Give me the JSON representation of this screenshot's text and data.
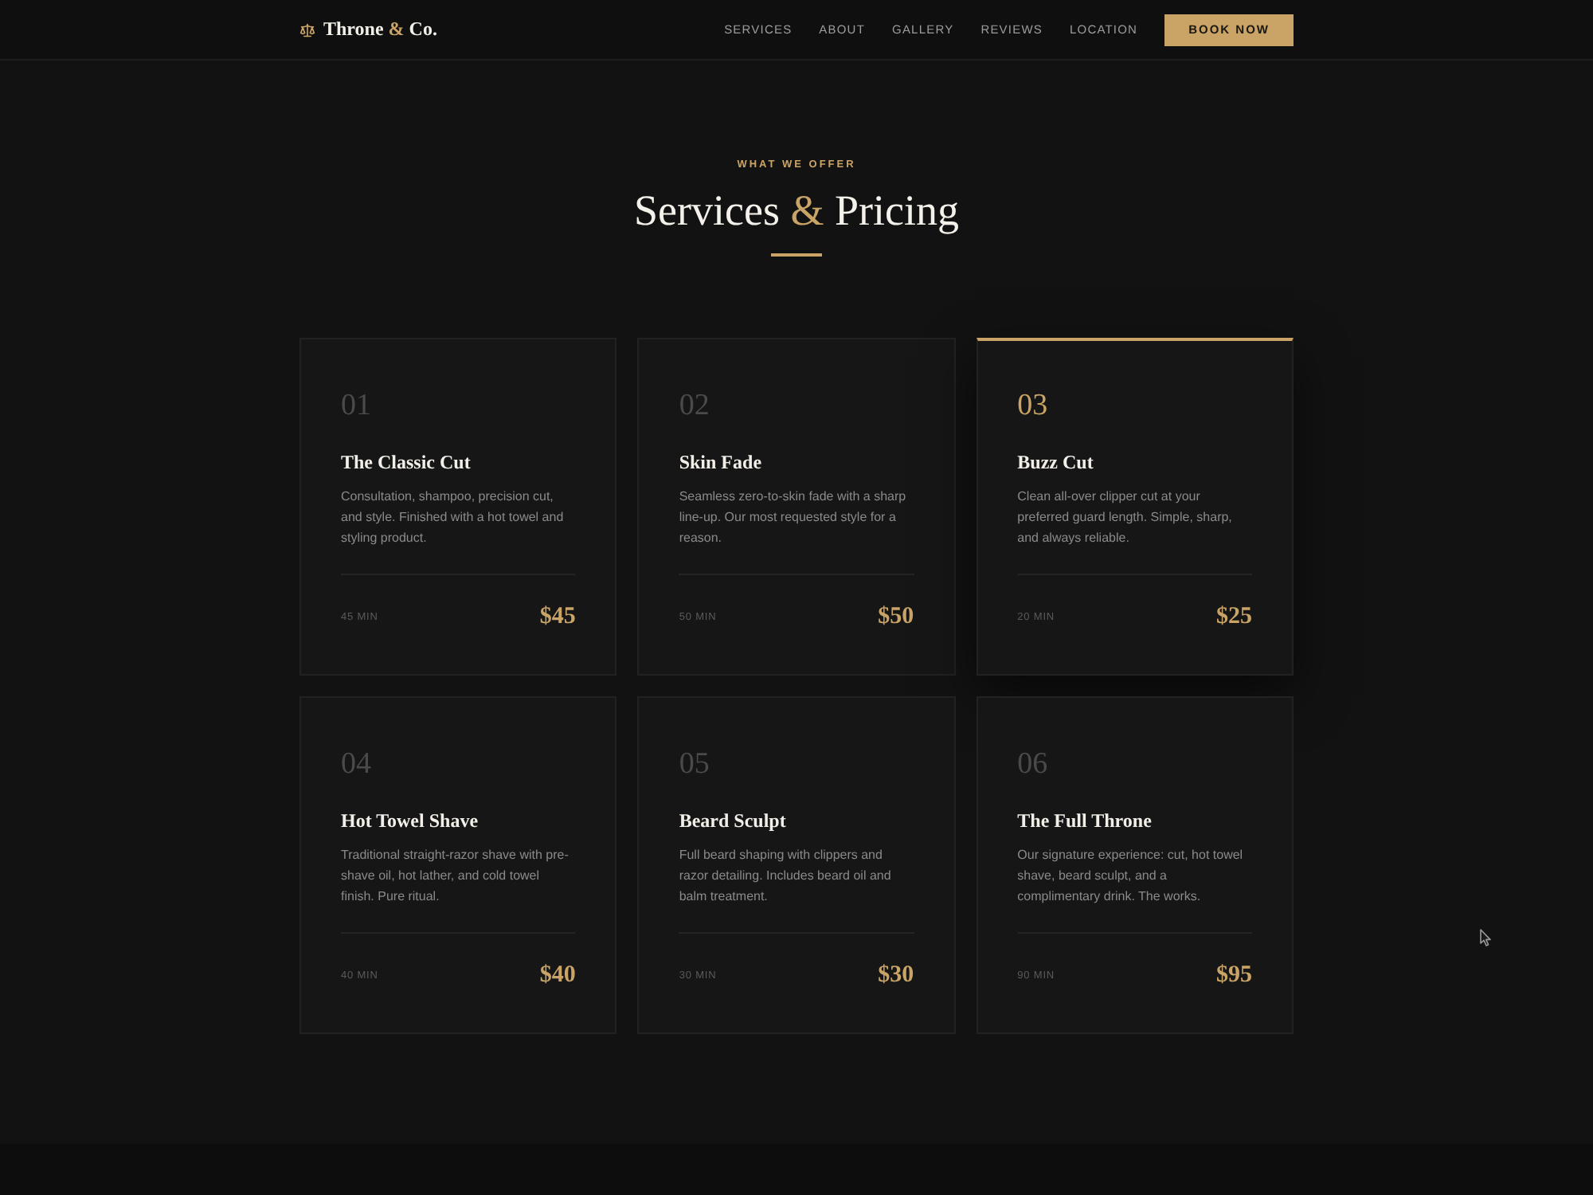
{
  "header": {
    "logo": {
      "name_start": "Throne",
      "ampersand": "&",
      "name_end": "Co."
    },
    "nav": [
      "SERVICES",
      "ABOUT",
      "GALLERY",
      "REVIEWS",
      "LOCATION"
    ],
    "cta": "BOOK NOW"
  },
  "section": {
    "eyebrow": "WHAT WE OFFER",
    "title": {
      "start": "Services",
      "ampersand": "&",
      "end": "Pricing"
    }
  },
  "services": [
    {
      "number": "01",
      "title": "The Classic Cut",
      "description": "Consultation, shampoo, precision cut, and style. Finished with a hot towel and styling product.",
      "duration": "45 MIN",
      "price": "$45",
      "highlighted": false
    },
    {
      "number": "02",
      "title": "Skin Fade",
      "description": "Seamless zero-to-skin fade with a sharp line-up. Our most requested style for a reason.",
      "duration": "50 MIN",
      "price": "$50",
      "highlighted": false
    },
    {
      "number": "03",
      "title": "Buzz Cut",
      "description": "Clean all-over clipper cut at your preferred guard length. Simple, sharp, and always reliable.",
      "duration": "20 MIN",
      "price": "$25",
      "highlighted": true
    },
    {
      "number": "04",
      "title": "Hot Towel Shave",
      "description": "Traditional straight-razor shave with pre-shave oil, hot lather, and cold towel finish. Pure ritual.",
      "duration": "40 MIN",
      "price": "$40",
      "highlighted": false
    },
    {
      "number": "05",
      "title": "Beard Sculpt",
      "description": "Full beard shaping with clippers and razor detailing. Includes beard oil and balm treatment.",
      "duration": "30 MIN",
      "price": "$30",
      "highlighted": false
    },
    {
      "number": "06",
      "title": "The Full Throne",
      "description": "Our signature experience: cut, hot towel shave, beard sculpt, and a complimentary drink. The works.",
      "duration": "90 MIN",
      "price": "$95",
      "highlighted": false
    }
  ]
}
